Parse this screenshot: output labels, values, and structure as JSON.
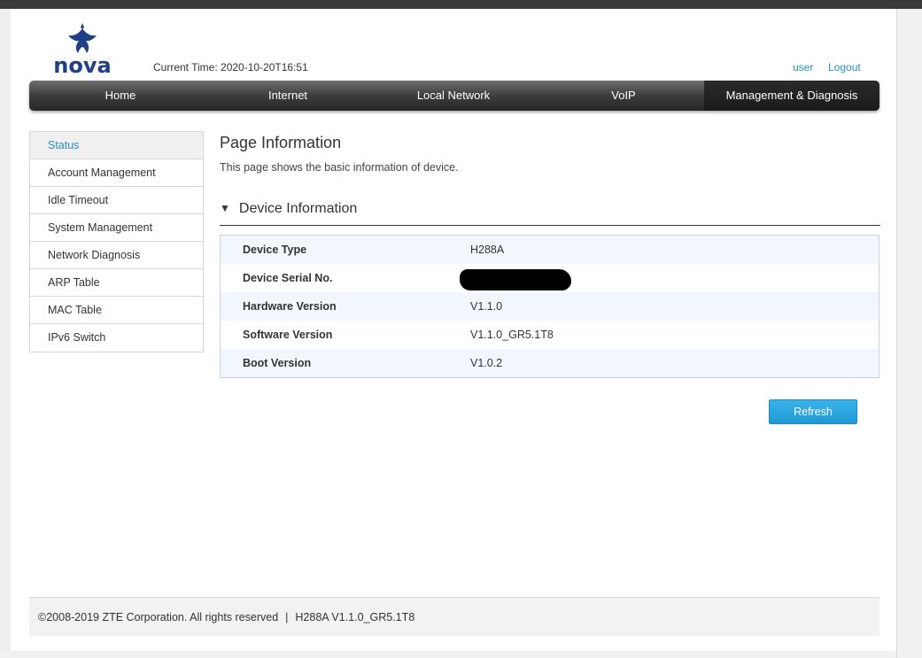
{
  "brand": {
    "logo_text": "nova",
    "logo_color": "#1f3f86"
  },
  "header": {
    "current_time": "Current Time: 2020-10-20T16:51",
    "user_link": "user",
    "logout_link": "Logout"
  },
  "nav": [
    {
      "label": "Home",
      "active": false
    },
    {
      "label": "Internet",
      "active": false
    },
    {
      "label": "Local Network",
      "active": false
    },
    {
      "label": "VoIP",
      "active": false
    },
    {
      "label": "Management & Diagnosis",
      "active": true
    }
  ],
  "sidebar": {
    "items": [
      {
        "label": "Status",
        "active": true
      },
      {
        "label": "Account Management",
        "active": false
      },
      {
        "label": "Idle Timeout",
        "active": false
      },
      {
        "label": "System Management",
        "active": false
      },
      {
        "label": "Network Diagnosis",
        "active": false
      },
      {
        "label": "ARP Table",
        "active": false
      },
      {
        "label": "MAC Table",
        "active": false
      },
      {
        "label": "IPv6 Switch",
        "active": false
      }
    ]
  },
  "main": {
    "title": "Page Information",
    "description": "This page shows the basic information of device.",
    "section_title": "Device Information",
    "rows": [
      {
        "label": "Device Type",
        "value": "H288A"
      },
      {
        "label": "Device Serial No.",
        "value": ""
      },
      {
        "label": "Hardware Version",
        "value": "V1.1.0"
      },
      {
        "label": "Software Version",
        "value": "V1.1.0_GR5.1T8"
      },
      {
        "label": "Boot Version",
        "value": "V1.0.2"
      }
    ],
    "refresh_label": "Refresh"
  },
  "footer": {
    "copyright": "©2008-2019 ZTE Corporation. All rights reserved",
    "separator": "|",
    "version": "H288A V1.1.0_GR5.1T8"
  },
  "colors": {
    "accent": "#2a8fc4",
    "button": "#1e9ad6",
    "nav_dark": "#262626"
  }
}
